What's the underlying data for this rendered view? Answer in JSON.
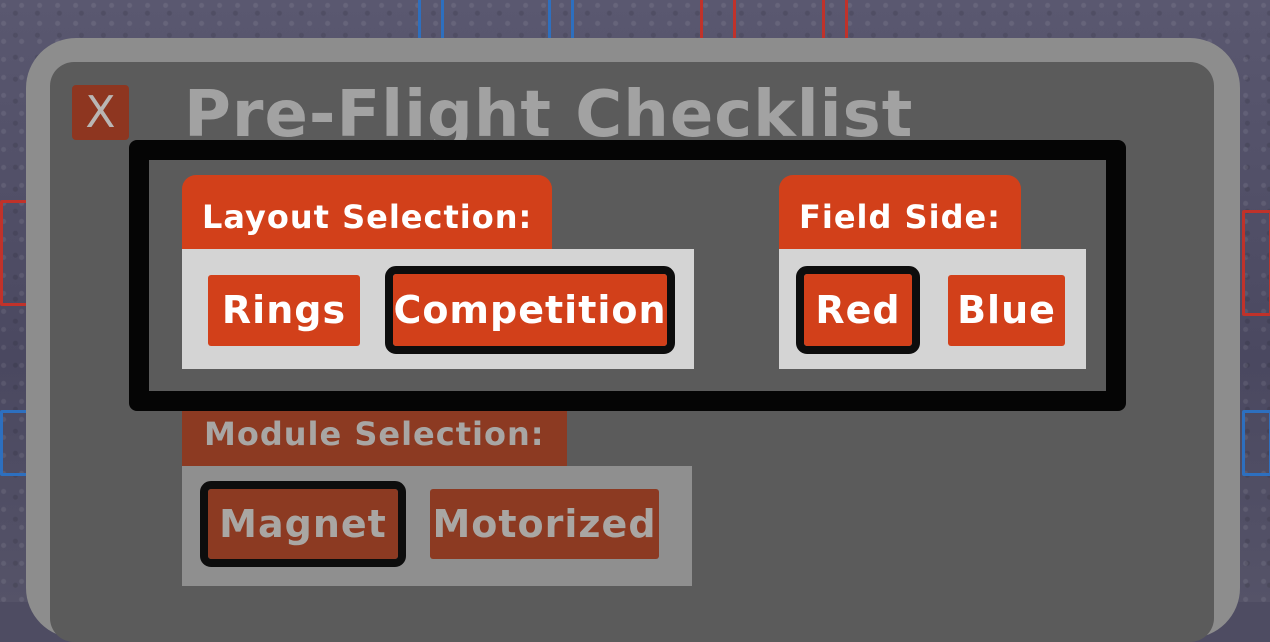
{
  "dialog": {
    "title": "Pre-Flight Checklist",
    "close_label": "X"
  },
  "layout_selection": {
    "label": "Layout Selection:",
    "options": [
      "Rings",
      "Competition"
    ],
    "selected": "Competition"
  },
  "field_side": {
    "label": "Field Side:",
    "options": [
      "Red",
      "Blue"
    ],
    "selected": "Red"
  },
  "module_selection": {
    "label": "Module Selection:",
    "options": [
      "Magnet",
      "Motorized"
    ],
    "selected": "Magnet"
  },
  "colors": {
    "accent": "#d2401a",
    "selection_outline": "#0d0d0d",
    "panel": "#5b5b5b"
  }
}
